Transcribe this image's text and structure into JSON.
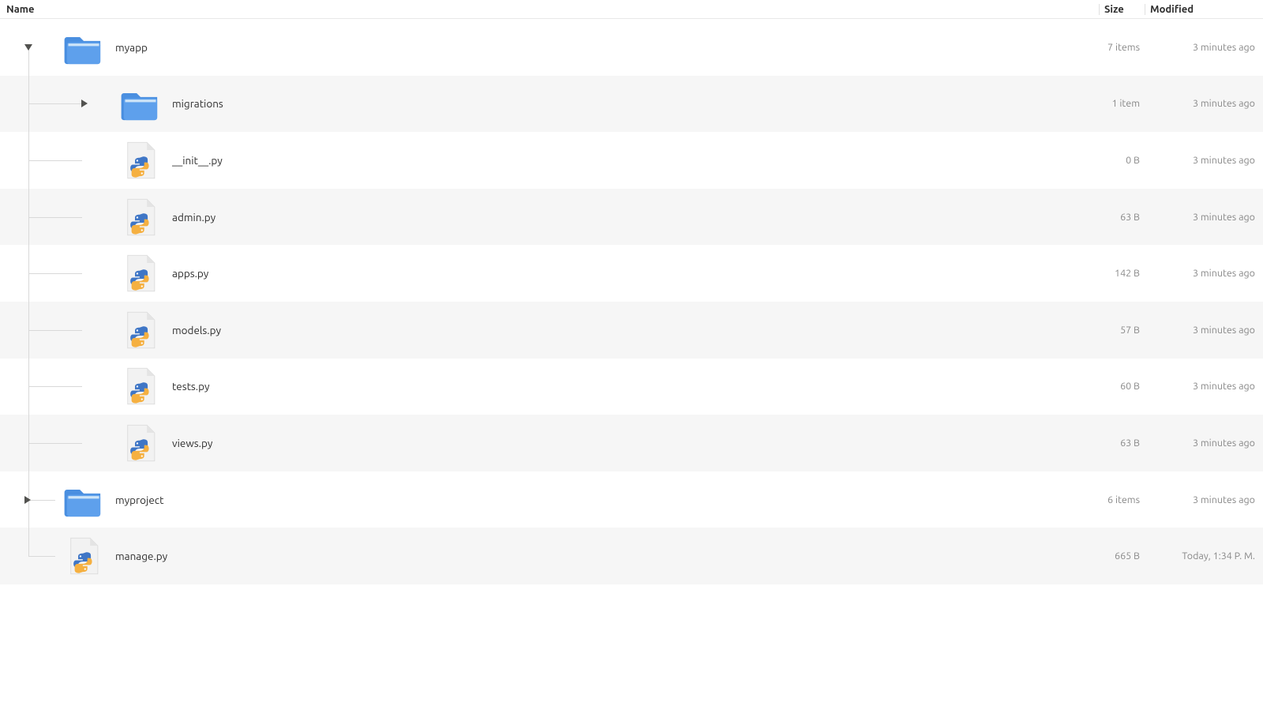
{
  "columns": {
    "name": "Name",
    "size": "Size",
    "modified": "Modified"
  },
  "rows": [
    {
      "indent": 0,
      "type": "folder",
      "expanded": true,
      "name": "myapp",
      "size": "7 items",
      "modified": "3 minutes ago"
    },
    {
      "indent": 1,
      "type": "folder",
      "expanded": false,
      "name": "migrations",
      "size": "1 item",
      "modified": "3 minutes ago"
    },
    {
      "indent": 1,
      "type": "python",
      "name": "__init__.py",
      "size": "0 B",
      "modified": "3 minutes ago"
    },
    {
      "indent": 1,
      "type": "python",
      "name": "admin.py",
      "size": "63 B",
      "modified": "3 minutes ago"
    },
    {
      "indent": 1,
      "type": "python",
      "name": "apps.py",
      "size": "142 B",
      "modified": "3 minutes ago"
    },
    {
      "indent": 1,
      "type": "python",
      "name": "models.py",
      "size": "57 B",
      "modified": "3 minutes ago"
    },
    {
      "indent": 1,
      "type": "python",
      "name": "tests.py",
      "size": "60 B",
      "modified": "3 minutes ago"
    },
    {
      "indent": 1,
      "type": "python",
      "name": "views.py",
      "size": "63 B",
      "modified": "3 minutes ago"
    },
    {
      "indent": 0,
      "type": "folder",
      "expanded": false,
      "name": "myproject",
      "size": "6 items",
      "modified": "3 minutes ago"
    },
    {
      "indent": 0,
      "type": "python",
      "name": "manage.py",
      "size": "665 B",
      "modified": "Today, 1:34 P. M."
    }
  ]
}
